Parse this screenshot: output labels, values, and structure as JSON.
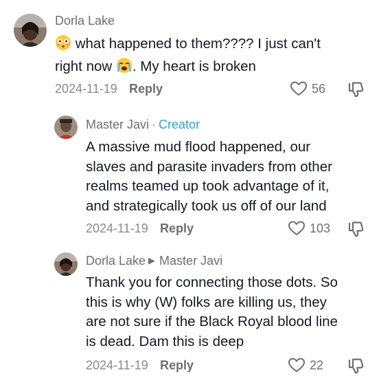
{
  "comments": [
    {
      "username": "Dorla Lake",
      "text_part1": "what happened to them???? I just can't",
      "text_part2": "right now",
      "text_part3": ". My heart is broken",
      "date": "2024-11-19",
      "reply_label": "Reply",
      "likes": "56"
    },
    {
      "username": "Master Javi",
      "badge": "Creator",
      "separator": "·",
      "lines": [
        "A massive mud flood happened, our",
        "slaves and parasite invaders from other",
        "realms teamed up took advantage of it,",
        "and strategically took us off of our land"
      ],
      "date": "2024-11-19",
      "reply_label": "Reply",
      "likes": "103"
    },
    {
      "username": "Dorla Lake",
      "reply_to": "Master Javi",
      "lines": [
        "Thank you for connecting those dots. So",
        "this is why (W) folks are killing us, they",
        "are not sure if the Black Royal blood line",
        "is dead. Dam this is deep"
      ],
      "date": "2024-11-19",
      "reply_label": "Reply",
      "likes": "22"
    }
  ],
  "icons": [
    "flushed-face-emoji-icon",
    "crying-face-emoji-icon",
    "heart-outline-icon",
    "dislike-icon",
    "reply-arrow-icon"
  ]
}
